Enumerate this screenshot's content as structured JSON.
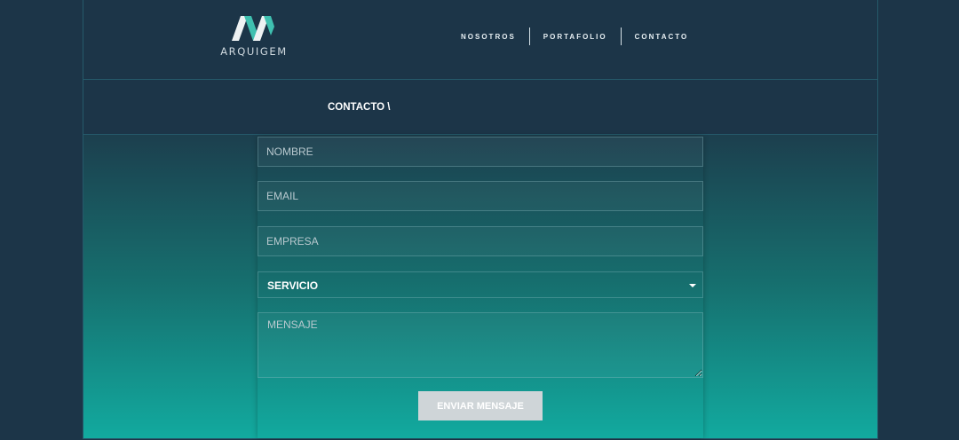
{
  "brand": {
    "name": "ARQUIGEM",
    "colors": {
      "teal": "#3fc0b0",
      "light": "#eef2f3"
    }
  },
  "nav": {
    "items": [
      {
        "label": "NOSOTROS"
      },
      {
        "label": "PORTAFOLIO"
      },
      {
        "label": "CONTACTO"
      }
    ]
  },
  "breadcrumb": {
    "label": "CONTACTO \\"
  },
  "form": {
    "name_placeholder": "NOMBRE",
    "email_placeholder": "EMAIL",
    "company_placeholder": "EMPRESA",
    "service_select": {
      "selected": "SERVICIO"
    },
    "message_placeholder": "MENSAJE",
    "submit_label": "ENVIAR MENSAJE"
  },
  "colors": {
    "background": "#1c3548",
    "gradient_top": "#1c3f4e",
    "gradient_bottom": "#12aa9f",
    "button": "#cfd5d8"
  }
}
